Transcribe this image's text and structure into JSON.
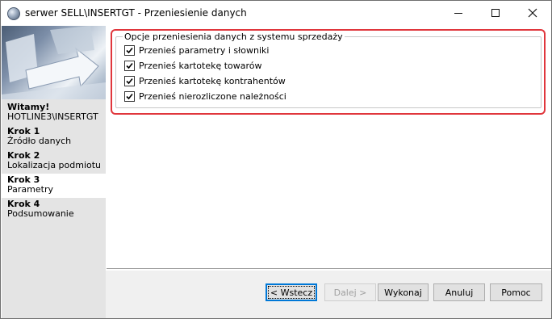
{
  "window": {
    "title": "serwer SELL\\INSERTGT - Przeniesienie danych"
  },
  "sidebar": {
    "steps": [
      {
        "title": "Witamy!",
        "sub": "HOTLINE3\\INSERTGT",
        "active": false
      },
      {
        "title": "Krok 1",
        "sub": "Źródło danych",
        "active": false
      },
      {
        "title": "Krok 2",
        "sub": "Lokalizacja podmiotu",
        "active": false
      },
      {
        "title": "Krok 3",
        "sub": "Parametry",
        "active": true
      },
      {
        "title": "Krok 4",
        "sub": "Podsumowanie",
        "active": false
      }
    ]
  },
  "main": {
    "group_title": "Opcje przeniesienia danych z systemu sprzedaży",
    "options": [
      {
        "label": "Przenieś parametry i słowniki",
        "checked": true
      },
      {
        "label": "Przenieś kartotekę towarów",
        "checked": true
      },
      {
        "label": "Przenieś kartotekę kontrahentów",
        "checked": true
      },
      {
        "label": "Przenieś nierozliczone należności",
        "checked": true
      }
    ]
  },
  "buttons": {
    "back": "< Wstecz",
    "next": "Dalej >",
    "execute": "Wykonaj",
    "cancel": "Anuluj",
    "help": "Pomoc"
  },
  "colors": {
    "highlight": "#e0363c",
    "sidebar_bg": "#e4e4e4",
    "default_button_border": "#0078d7"
  }
}
